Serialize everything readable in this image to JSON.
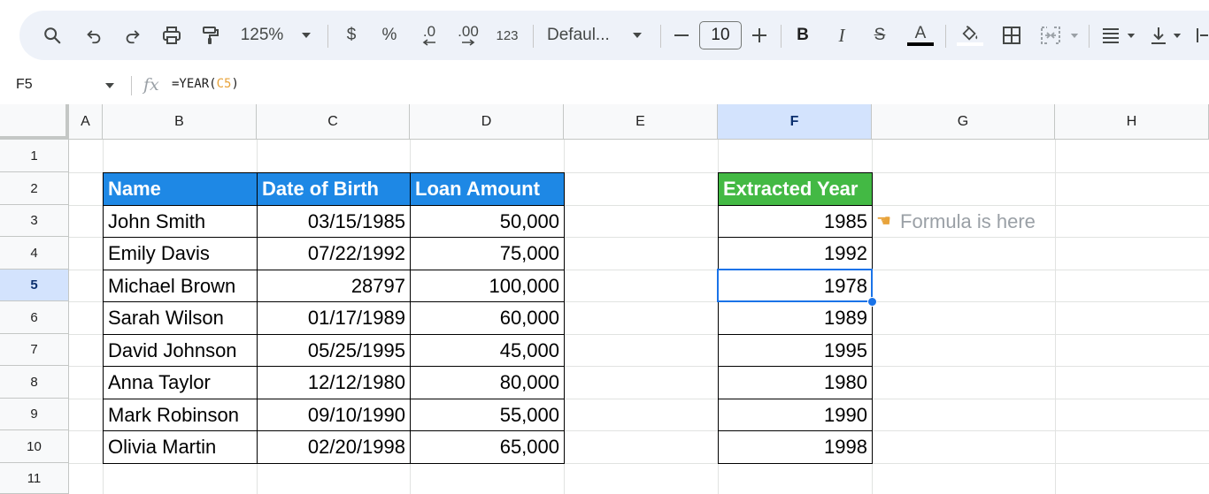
{
  "toolbar": {
    "zoom": "125%",
    "currency": "$",
    "percent": "%",
    "dec_decrease": ".0",
    "dec_increase": ".00",
    "number_format": "123",
    "font_family": "Defaul...",
    "font_size": "10",
    "bold": "B",
    "italic": "I",
    "strike": "S",
    "text_color": "A"
  },
  "formula_bar": {
    "cell_ref": "F5",
    "formula_prefix": "=YEAR(",
    "formula_ref": "C5",
    "formula_suffix": ")"
  },
  "columns": [
    "A",
    "B",
    "C",
    "D",
    "E",
    "F",
    "G",
    "H"
  ],
  "rows": [
    "1",
    "2",
    "3",
    "4",
    "5",
    "6",
    "7",
    "8",
    "9",
    "10",
    "11"
  ],
  "table": {
    "headers": {
      "name": "Name",
      "dob": "Date of Birth",
      "loan": "Loan Amount"
    },
    "data": [
      {
        "name": "John Smith",
        "dob": "03/15/1985",
        "loan": "50,000"
      },
      {
        "name": "Emily Davis",
        "dob": "07/22/1992",
        "loan": "75,000"
      },
      {
        "name": "Michael Brown",
        "dob": "28797",
        "loan": "100,000"
      },
      {
        "name": "Sarah Wilson",
        "dob": "01/17/1989",
        "loan": "60,000"
      },
      {
        "name": "David Johnson",
        "dob": "05/25/1995",
        "loan": "45,000"
      },
      {
        "name": "Anna Taylor",
        "dob": "12/12/1980",
        "loan": "80,000"
      },
      {
        "name": "Mark Robinson",
        "dob": "09/10/1990",
        "loan": "55,000"
      },
      {
        "name": "Olivia Martin",
        "dob": "02/20/1998",
        "loan": "65,000"
      }
    ]
  },
  "years": {
    "header": "Extracted Year",
    "values": [
      "1985",
      "1992",
      "1978",
      "1989",
      "1995",
      "1980",
      "1990",
      "1998"
    ]
  },
  "annotation": {
    "text": "Formula is here"
  },
  "colors": {
    "header_blue": "#1e88e5",
    "header_green": "#43b944",
    "selection": "#1a73e8"
  }
}
